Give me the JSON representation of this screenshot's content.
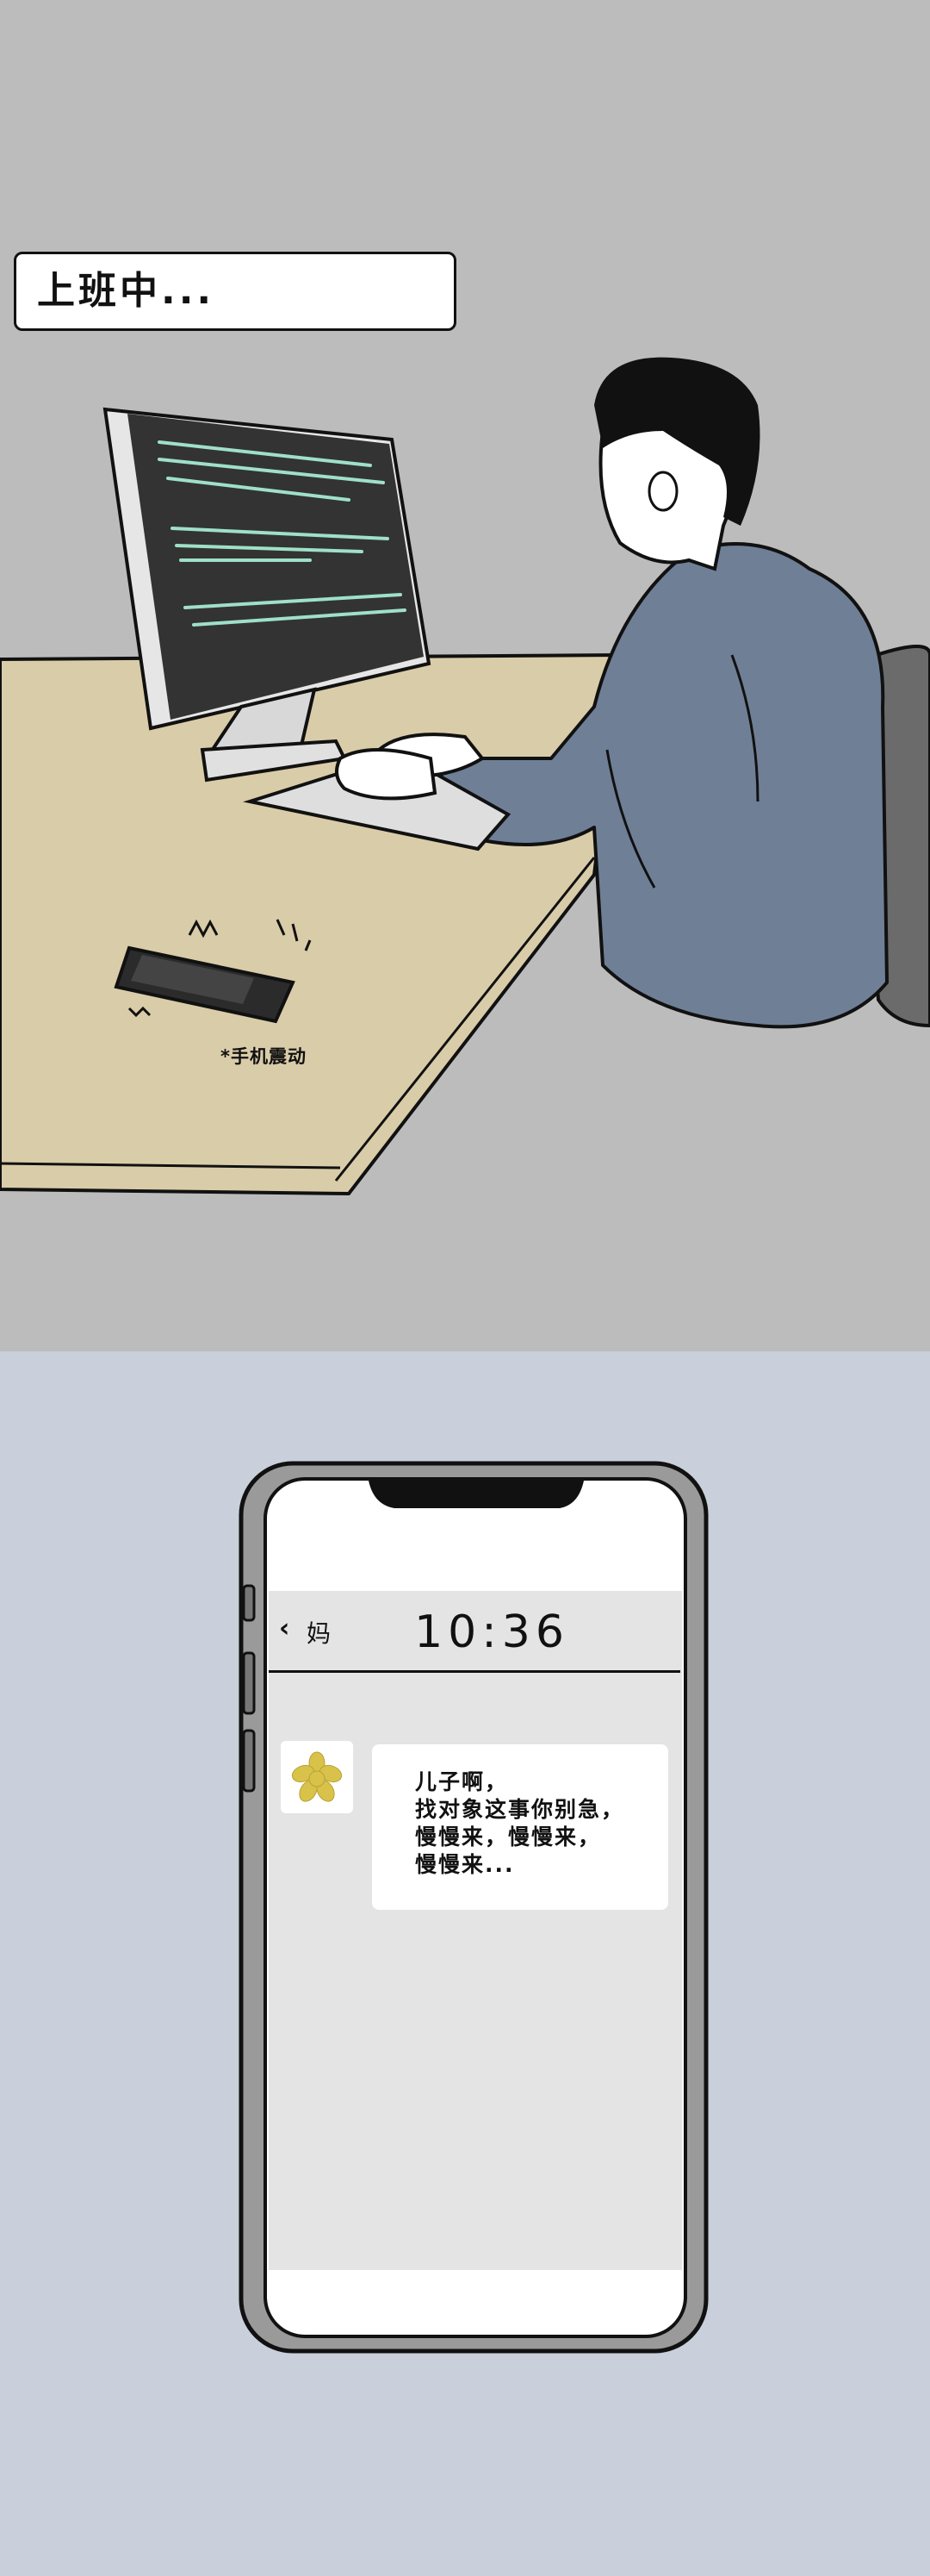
{
  "panel1": {
    "caption": "上班中...",
    "vibration_note": "*手机震动"
  },
  "panel2": {
    "chat": {
      "back_icon": "chevron-left-icon",
      "contact_name": "妈",
      "time": "10:36",
      "avatar_icon": "flower-icon",
      "message_lines": [
        "儿子啊，",
        "找对象这事你别急，",
        "慢慢来，慢慢来，",
        "慢慢来..."
      ]
    }
  },
  "colors": {
    "top_background": "#bcbcbc",
    "bottom_background": "#c9cfdb",
    "desk": "#d9cca8",
    "shirt": "#6f7f96",
    "monitor_screen": "#333333",
    "code_lines": "#9fe0c8",
    "chat_background": "#e4e4e4",
    "avatar_flower": "#d8c24a"
  }
}
